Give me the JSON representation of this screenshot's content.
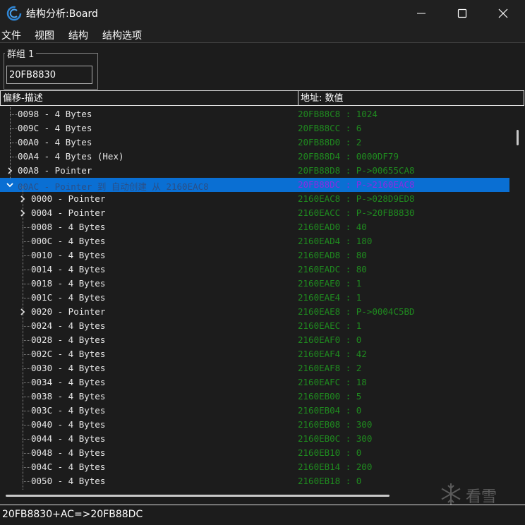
{
  "window": {
    "title": "结构分析:Board",
    "controls": [
      "minimize",
      "maximize",
      "close"
    ]
  },
  "menu": {
    "items": [
      "文件",
      "视图",
      "结构",
      "结构选项"
    ]
  },
  "group": {
    "label": "群组 1",
    "address_value": "20FB8830"
  },
  "columns": {
    "offset_desc": "偏移-描述",
    "address_value": "地址: 数值"
  },
  "rows": [
    {
      "level": 0,
      "expander": "none",
      "desc": "0098 - 4 Bytes",
      "value": "20FB88C8 : 1024"
    },
    {
      "level": 0,
      "expander": "none",
      "desc": "009C - 4 Bytes",
      "value": "20FB88CC : 6"
    },
    {
      "level": 0,
      "expander": "none",
      "desc": "00A0 - 4 Bytes",
      "value": "20FB88D0 : 2"
    },
    {
      "level": 0,
      "expander": "none",
      "desc": "00A4 - 4 Bytes (Hex)",
      "value": "20FB88D4 : 0000DF79"
    },
    {
      "level": 0,
      "expander": "collapsed",
      "desc": "00A8 - Pointer",
      "value": "20FB88D8 : P->00655CA8"
    },
    {
      "level": 0,
      "expander": "expanded",
      "desc": "00AC - Pointer 到 自动创建 从 2160EAC8",
      "value": "20FB88DC : P->2160EAC8",
      "selected": true
    },
    {
      "level": 1,
      "expander": "collapsed",
      "desc": "0000 - Pointer",
      "value": "2160EAC8 : P->028D9ED8"
    },
    {
      "level": 1,
      "expander": "collapsed",
      "desc": "0004 - Pointer",
      "value": "2160EACC : P->20FB8830"
    },
    {
      "level": 1,
      "expander": "none",
      "desc": "0008 - 4 Bytes",
      "value": "2160EAD0 : 40"
    },
    {
      "level": 1,
      "expander": "none",
      "desc": "000C - 4 Bytes",
      "value": "2160EAD4 : 180"
    },
    {
      "level": 1,
      "expander": "none",
      "desc": "0010 - 4 Bytes",
      "value": "2160EAD8 : 80"
    },
    {
      "level": 1,
      "expander": "none",
      "desc": "0014 - 4 Bytes",
      "value": "2160EADC : 80"
    },
    {
      "level": 1,
      "expander": "none",
      "desc": "0018 - 4 Bytes",
      "value": "2160EAE0 : 1"
    },
    {
      "level": 1,
      "expander": "none",
      "desc": "001C - 4 Bytes",
      "value": "2160EAE4 : 1"
    },
    {
      "level": 1,
      "expander": "collapsed",
      "desc": "0020 - Pointer",
      "value": "2160EAE8 : P->0004C5BD"
    },
    {
      "level": 1,
      "expander": "none",
      "desc": "0024 - 4 Bytes",
      "value": "2160EAEC : 1"
    },
    {
      "level": 1,
      "expander": "none",
      "desc": "0028 - 4 Bytes",
      "value": "2160EAF0 : 0"
    },
    {
      "level": 1,
      "expander": "none",
      "desc": "002C - 4 Bytes",
      "value": "2160EAF4 : 42"
    },
    {
      "level": 1,
      "expander": "none",
      "desc": "0030 - 4 Bytes",
      "value": "2160EAF8 : 2"
    },
    {
      "level": 1,
      "expander": "none",
      "desc": "0034 - 4 Bytes",
      "value": "2160EAFC : 18"
    },
    {
      "level": 1,
      "expander": "none",
      "desc": "0038 - 4 Bytes",
      "value": "2160EB00 : 5"
    },
    {
      "level": 1,
      "expander": "none",
      "desc": "003C - 4 Bytes",
      "value": "2160EB04 : 0"
    },
    {
      "level": 1,
      "expander": "none",
      "desc": "0040 - 4 Bytes",
      "value": "2160EB08 : 300"
    },
    {
      "level": 1,
      "expander": "none",
      "desc": "0044 - 4 Bytes",
      "value": "2160EB0C : 300"
    },
    {
      "level": 1,
      "expander": "none",
      "desc": "0048 - 4 Bytes",
      "value": "2160EB10 : 0"
    },
    {
      "level": 1,
      "expander": "none",
      "desc": "004C - 4 Bytes",
      "value": "2160EB14 : 200"
    },
    {
      "level": 1,
      "expander": "none",
      "desc": "0050 - 4 Bytes",
      "value": "2160EB18 : 0"
    }
  ],
  "status": {
    "text": "20FB8830+AC=>20FB88DC"
  },
  "watermark": {
    "text": "看雪",
    "icon": "snowflake-icon"
  },
  "colors": {
    "selection": "#0a6fd3",
    "value_text": "#1f8a1f",
    "selected_value_text": "#8a2be2"
  }
}
